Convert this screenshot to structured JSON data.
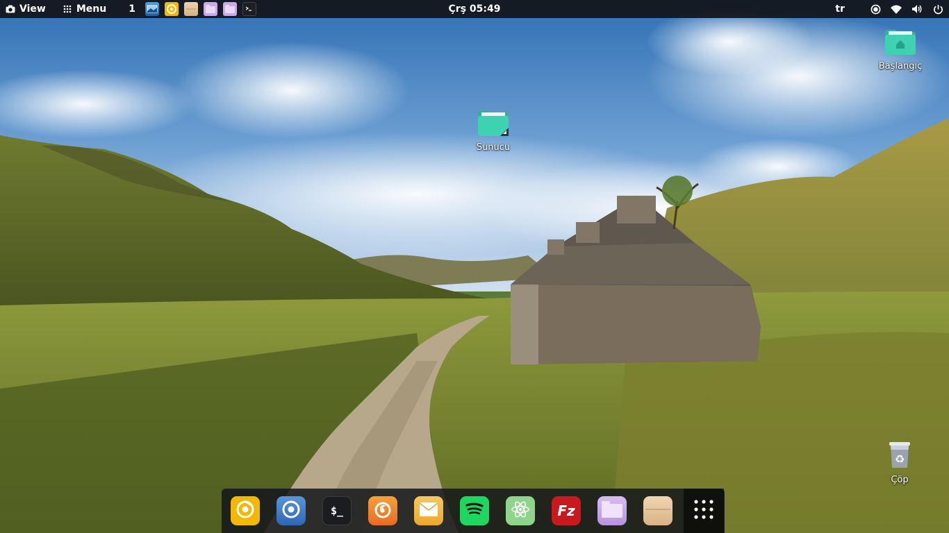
{
  "panel": {
    "view_label": "View",
    "menu_label": "Menu",
    "workspace": "1",
    "clock": "Çrş 05:49",
    "language": "tr",
    "tasks": [
      "screenshot-app-icon",
      "chrome-icon",
      "files-icon",
      "folder-icon",
      "folder-icon",
      "terminal-icon"
    ],
    "tray": [
      "record-icon",
      "wifi-icon",
      "volume-icon",
      "power-icon"
    ]
  },
  "desktop": {
    "icons": [
      {
        "label": "Sunucu",
        "icon": "network-folder-icon"
      },
      {
        "label": "Başlangıç",
        "icon": "home-folder-icon"
      },
      {
        "label": "Çöp",
        "icon": "trash-icon"
      }
    ]
  },
  "dock": {
    "items": [
      "chrome-icon",
      "chromium-icon",
      "terminal-icon",
      "firefox-icon",
      "mail-icon",
      "spotify-icon",
      "atom-icon",
      "filezilla-icon",
      "folder-icon",
      "files-icon",
      "app-grid-icon"
    ],
    "terminal_text": "$_",
    "filezilla_text": "Fz"
  },
  "colors": {
    "panel_bg": "#121418",
    "folder_teal": "#3ed1b2",
    "chrome_yellow": "#f5b800",
    "chromium_blue": "#3d7cc9",
    "firefox_orange": "#f07b2a",
    "mail_yellow": "#f3b740",
    "spotify_green": "#1ed760",
    "atom_green": "#8ed48a",
    "filezilla_red": "#c8191e",
    "folder_purple": "#c9a9e8",
    "files_beige": "#e4c59b"
  }
}
